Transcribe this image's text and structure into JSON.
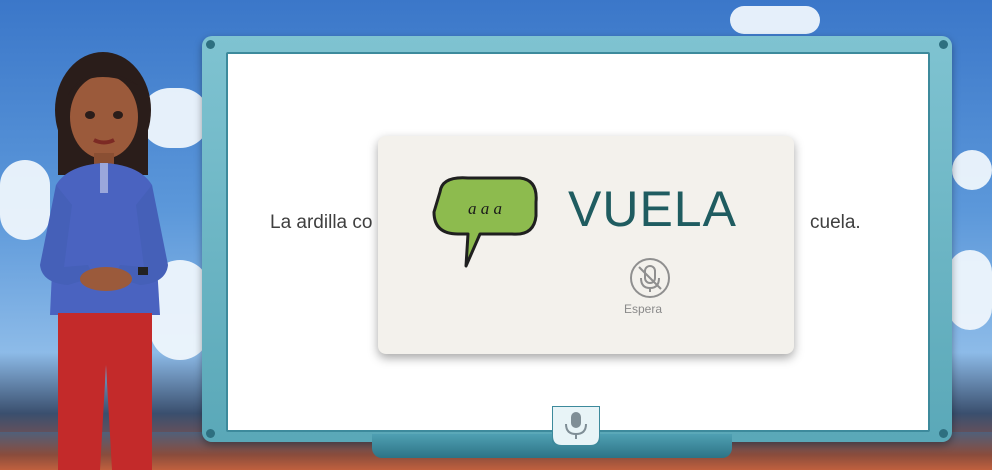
{
  "lesson": {
    "sentence_start": "La ardilla co",
    "sentence_end": "cuela."
  },
  "card": {
    "word": "VUELA",
    "bubble_letters": "a a a",
    "status": "Espera"
  },
  "colors": {
    "word": "#1f5c60",
    "bubble": "#8dbb4e",
    "monitor_frame": "#5aa8b8"
  },
  "icons": {
    "status": "microphone-muted-icon",
    "bottom": "microphone-icon",
    "bubble": "speech-bubble-icon"
  }
}
